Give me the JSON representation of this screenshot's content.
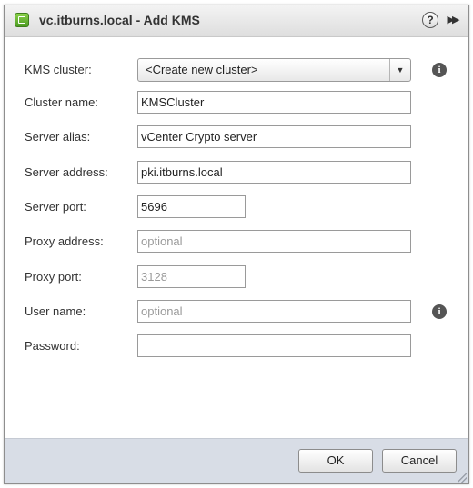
{
  "dialog": {
    "title": "vc.itburns.local - Add KMS",
    "help_icon": "?",
    "expand_icon": "▶▶"
  },
  "form": {
    "kms_cluster": {
      "label": "KMS cluster:",
      "value": "<Create new cluster>"
    },
    "cluster_name": {
      "label": "Cluster name:",
      "value": "KMSCluster"
    },
    "server_alias": {
      "label": "Server alias:",
      "value": "vCenter Crypto server"
    },
    "server_address": {
      "label": "Server address:",
      "value": "pki.itburns.local"
    },
    "server_port": {
      "label": "Server port:",
      "value": "5696"
    },
    "proxy_address": {
      "label": "Proxy address:",
      "placeholder": "optional"
    },
    "proxy_port": {
      "label": "Proxy port:",
      "placeholder": "3128"
    },
    "user_name": {
      "label": "User name:",
      "placeholder": "optional"
    },
    "password": {
      "label": "Password:",
      "value": ""
    }
  },
  "icons": {
    "info": "i",
    "dropdown_arrow": "▼"
  },
  "buttons": {
    "ok": "OK",
    "cancel": "Cancel"
  }
}
